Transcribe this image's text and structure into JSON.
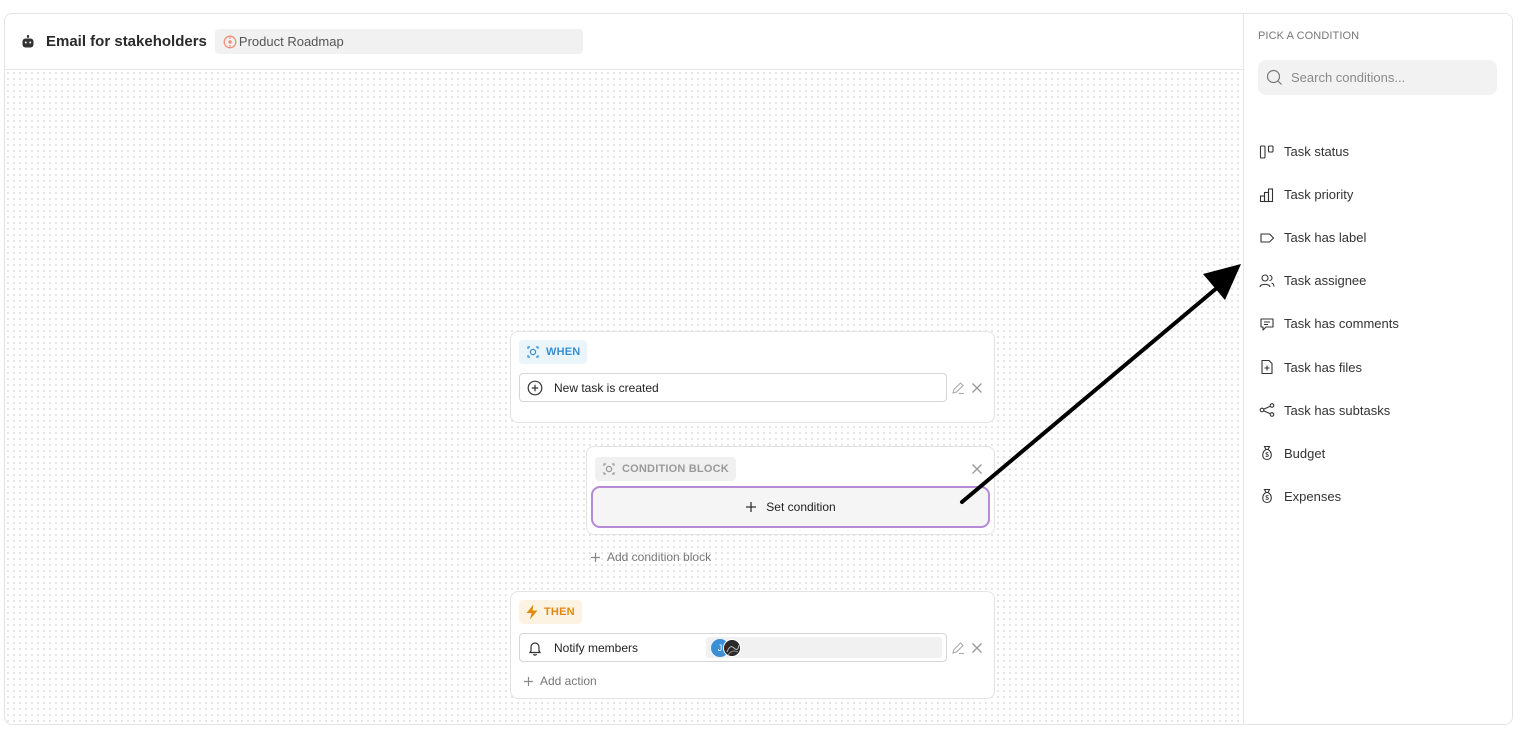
{
  "header": {
    "title": "Email for stakeholders",
    "project": "Product Roadmap"
  },
  "when_block": {
    "tag": "WHEN",
    "trigger": "New task is created"
  },
  "condition_block": {
    "tag": "CONDITION BLOCK",
    "set_condition": "Set condition",
    "add_condition_block": "Add condition block"
  },
  "then_block": {
    "tag": "THEN",
    "action": "Notify members",
    "member_initial": "J",
    "add_action": "Add action"
  },
  "sidebar": {
    "title": "PICK A CONDITION",
    "search_placeholder": "Search conditions...",
    "items": [
      {
        "label": "Task status",
        "icon": "kanban-icon"
      },
      {
        "label": "Task priority",
        "icon": "priority-bars-icon"
      },
      {
        "label": "Task has label",
        "icon": "label-tag-icon"
      },
      {
        "label": "Task assignee",
        "icon": "users-icon"
      },
      {
        "label": "Task has comments",
        "icon": "comment-icon"
      },
      {
        "label": "Task has files",
        "icon": "file-icon"
      },
      {
        "label": "Task has subtasks",
        "icon": "subtasks-icon"
      },
      {
        "label": "Budget",
        "icon": "money-bag-icon"
      },
      {
        "label": "Expenses",
        "icon": "money-bag-icon"
      }
    ]
  },
  "colors": {
    "when_accent": "#3b8fd0",
    "then_accent": "#e08a0b",
    "condition_border": "#b78ad6",
    "arrow": "#000000"
  }
}
